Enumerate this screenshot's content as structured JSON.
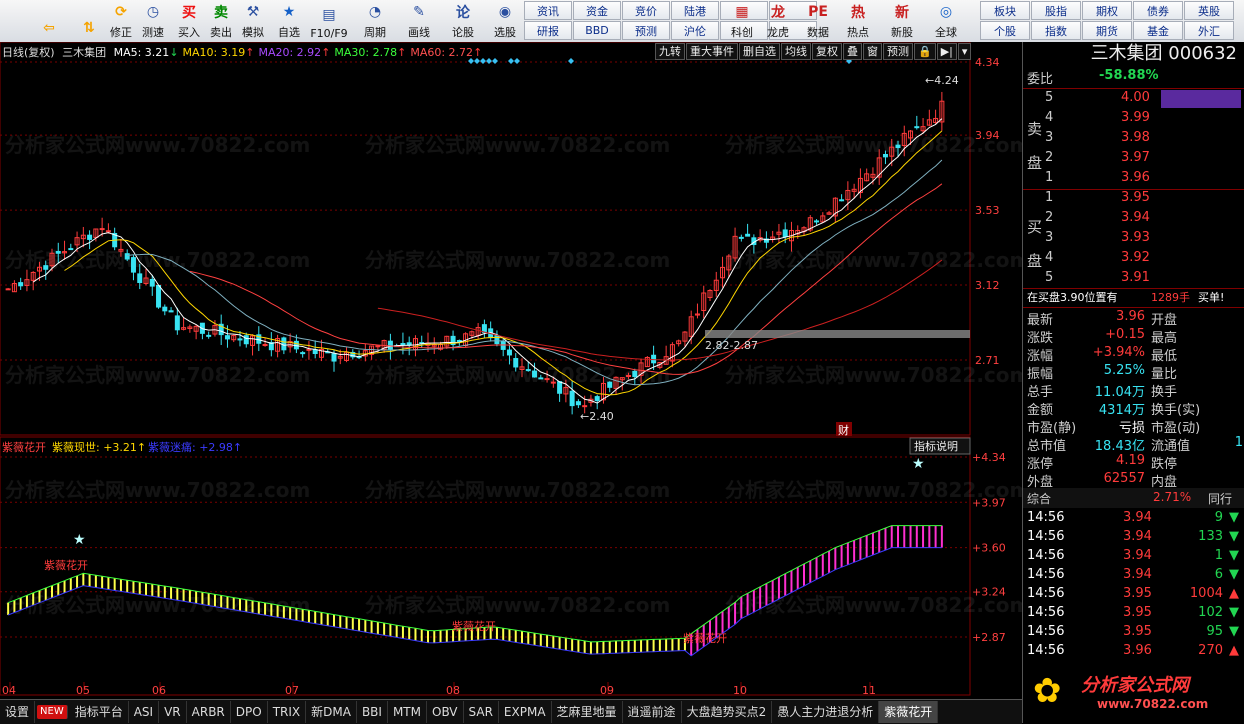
{
  "toolbar": {
    "left_buttons": [
      {
        "label": "",
        "icon": "arrow-left-icon"
      },
      {
        "label": "",
        "icon": "arrow-up-down-icon"
      },
      {
        "label": "修正",
        "icon": "refresh-icon"
      },
      {
        "label": "测速",
        "icon": "clock-icon"
      },
      {
        "label": "买入",
        "icon": "buy-icon"
      },
      {
        "label": "卖出",
        "icon": "sell-icon"
      },
      {
        "label": "模拟",
        "icon": "hammer-icon"
      },
      {
        "label": "自选",
        "icon": "star-icon"
      },
      {
        "label": "F10/F9",
        "icon": "f10-icon"
      },
      {
        "label": "周期",
        "icon": "cycle-icon"
      },
      {
        "label": "画线",
        "icon": "pencil-icon"
      },
      {
        "label": "论股",
        "icon": "discuss-icon"
      },
      {
        "label": "选股",
        "icon": "select-stock-icon"
      }
    ],
    "grid_buttons": [
      "资讯",
      "资金",
      "竞价",
      "陆港",
      "",
      "",
      "研报",
      "BBD",
      "预测",
      "沪伦",
      "",
      ""
    ],
    "mid_buttons": [
      {
        "label": "科创",
        "icon": "kechuang-icon"
      },
      {
        "label": "龙虎",
        "icon": "dragon-icon"
      },
      {
        "label": "数据",
        "icon": "pe-icon"
      },
      {
        "label": "热点",
        "icon": "hot-icon"
      },
      {
        "label": "新股",
        "icon": "new-stock-icon"
      },
      {
        "label": "全球",
        "icon": "globe-icon"
      }
    ],
    "right_grid": [
      "板块",
      "股指",
      "期权",
      "债券",
      "英股",
      "个股",
      "指数",
      "期货",
      "基金",
      "外汇"
    ]
  },
  "chart_header": {
    "period": "日线(复权)",
    "stock": "三木集团",
    "ma": [
      {
        "label": "MA5: 3.21",
        "arrow": "↓",
        "color": "#ffffff"
      },
      {
        "label": "MA10: 3.19",
        "arrow": "↑",
        "color": "#ffd700"
      },
      {
        "label": "MA20: 2.92",
        "arrow": "↑",
        "color": "#a94bff"
      },
      {
        "label": "MA30: 2.78",
        "arrow": "↑",
        "color": "#3cff3c"
      },
      {
        "label": "MA60: 2.72",
        "arrow": "↑",
        "color": "#ff5050"
      }
    ],
    "buttons": [
      "九转",
      "重大事件",
      "删自选",
      "均线",
      "复权",
      "叠",
      "窗",
      "预测",
      "🔒",
      "▶|",
      "▾"
    ]
  },
  "price_axis": [
    "4.34",
    "3.94",
    "3.53",
    "3.12",
    "2.71"
  ],
  "annotations": {
    "high": "4.24",
    "low": "2.40",
    "range": "2.82-2.87",
    "cai": "财"
  },
  "indicator": {
    "name": "紫薇花开",
    "line1_label": "紫薇现世:",
    "line1_value": "+3.21",
    "line1_arrow": "↑",
    "line2_label": "紫薇迷痛:",
    "line2_value": "+2.98",
    "line2_arrow": "↑",
    "help": "指标说明",
    "axis": [
      "+4.34",
      "+3.97",
      "+3.60",
      "+3.24",
      "+2.87"
    ],
    "signals": [
      "紫薇花开",
      "紫薇花开",
      "紫薇花开"
    ]
  },
  "x_axis": [
    "04",
    "05",
    "06",
    "07",
    "08",
    "09",
    "10",
    "11"
  ],
  "bottom_tabs": [
    "设置",
    "NEW",
    "指标平台",
    "ASI",
    "VR",
    "ARBR",
    "DPO",
    "TRIX",
    "新DMA",
    "BBI",
    "MTM",
    "OBV",
    "SAR",
    "EXPMA",
    "芝麻里地量",
    "逍遥前途",
    "大盘趋势买点2",
    "愚人主力进退分析",
    "紫薇花开"
  ],
  "quote": {
    "title": "三木集团 000632",
    "weibi_label": "委比",
    "weibi": "-58.88%",
    "sell_label": "卖盘",
    "buy_label": "买盘",
    "sell": [
      {
        "lvl": "5",
        "price": "4.00",
        "vol": ""
      },
      {
        "lvl": "4",
        "price": "3.99",
        "vol": ""
      },
      {
        "lvl": "3",
        "price": "3.98",
        "vol": ""
      },
      {
        "lvl": "2",
        "price": "3.97",
        "vol": ""
      },
      {
        "lvl": "1",
        "price": "3.96",
        "vol": ""
      }
    ],
    "buy": [
      {
        "lvl": "1",
        "price": "3.95",
        "vol": ""
      },
      {
        "lvl": "2",
        "price": "3.94",
        "vol": ""
      },
      {
        "lvl": "3",
        "price": "3.93",
        "vol": ""
      },
      {
        "lvl": "4",
        "price": "3.92",
        "vol": ""
      },
      {
        "lvl": "5",
        "price": "3.91",
        "vol": ""
      }
    ],
    "notice": "在买盘3.90位置有",
    "notice_vol": "1289手",
    "notice_tag": "买单!",
    "stats": [
      {
        "l1": "最新",
        "v1": "3.96",
        "c1": "red",
        "l2": "开盘"
      },
      {
        "l1": "涨跌",
        "v1": "+0.15",
        "c1": "red",
        "l2": "最高"
      },
      {
        "l1": "涨幅",
        "v1": "+3.94%",
        "c1": "red",
        "l2": "最低"
      },
      {
        "l1": "振幅",
        "v1": "5.25%",
        "c1": "cyan",
        "l2": "量比"
      },
      {
        "l1": "总手",
        "v1": "11.04万",
        "c1": "cyan",
        "l2": "换手"
      },
      {
        "l1": "金额",
        "v1": "4314万",
        "c1": "cyan",
        "l2": "换手(实)"
      },
      {
        "l1": "市盈(静)",
        "v1": "亏损",
        "c1": "white",
        "l2": "市盈(动)"
      },
      {
        "l1": "总市值",
        "v1": "18.43亿",
        "c1": "cyan",
        "l2": "流通值",
        "v2": "1"
      },
      {
        "l1": "涨停",
        "v1": "4.19",
        "c1": "red",
        "l2": "跌停"
      },
      {
        "l1": "外盘",
        "v1": "62557",
        "c1": "red",
        "l2": "内盘"
      }
    ],
    "composite_label": "综合",
    "composite_value": "2.71%",
    "same_trade": "同行",
    "ticks": [
      {
        "t": "14:56",
        "p": "3.94",
        "v": "9",
        "dir": "down"
      },
      {
        "t": "14:56",
        "p": "3.94",
        "v": "133",
        "dir": "down"
      },
      {
        "t": "14:56",
        "p": "3.94",
        "v": "1",
        "dir": "down"
      },
      {
        "t": "14:56",
        "p": "3.94",
        "v": "6",
        "dir": "down"
      },
      {
        "t": "14:56",
        "p": "3.95",
        "v": "1004",
        "dir": "up"
      },
      {
        "t": "14:56",
        "p": "3.95",
        "v": "102",
        "dir": "down"
      },
      {
        "t": "14:56",
        "p": "3.95",
        "v": "95",
        "dir": "down"
      },
      {
        "t": "14:56",
        "p": "3.96",
        "v": "270",
        "dir": "up"
      }
    ],
    "logo": "分析家公式网",
    "logo_url": "www.70822.com"
  },
  "watermark": "分析家公式网www.70822.com"
}
